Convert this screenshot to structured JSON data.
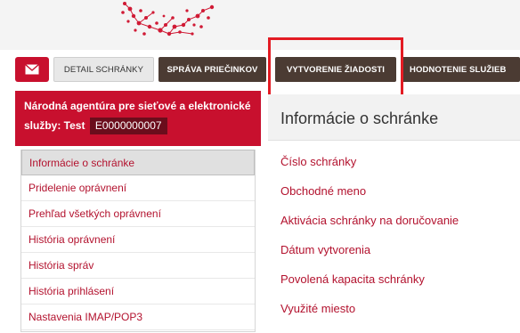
{
  "colors": {
    "brand_red": "#c8102e",
    "nav_dark": "#4b3b33",
    "highlight": "#e31b23"
  },
  "header": {
    "logo_icon": "snowflake-ornament-logo"
  },
  "nav": {
    "mail_icon": "envelope-icon",
    "tabs": [
      {
        "label": "DETAIL SCHRÁNKY"
      },
      {
        "label": "SPRÁVA PRIEČINKOV"
      },
      {
        "label": "VYTVORENIE ŽIADOSTI"
      },
      {
        "label": "HODNOTENIE SLUŽIEB"
      }
    ]
  },
  "sidebar": {
    "owner_name": "Národná agentúra pre sieťové a elektronické služby: Test",
    "box_id": "E0000000007",
    "items": [
      {
        "label": "Informácie o schránke"
      },
      {
        "label": "Pridelenie oprávnení"
      },
      {
        "label": "Prehľad všetkých oprávnení"
      },
      {
        "label": "História oprávnení"
      },
      {
        "label": "História správ"
      },
      {
        "label": "História prihlásení"
      },
      {
        "label": "Nastavenia IMAP/POP3"
      }
    ]
  },
  "main": {
    "title": "Informácie o schránke",
    "fields": [
      {
        "label": "Číslo schránky"
      },
      {
        "label": "Obchodné meno"
      },
      {
        "label": "Aktivácia schránky na doručovanie"
      },
      {
        "label": "Dátum vytvorenia"
      },
      {
        "label": "Povolená kapacita schránky"
      },
      {
        "label": "Využité miesto"
      }
    ]
  }
}
